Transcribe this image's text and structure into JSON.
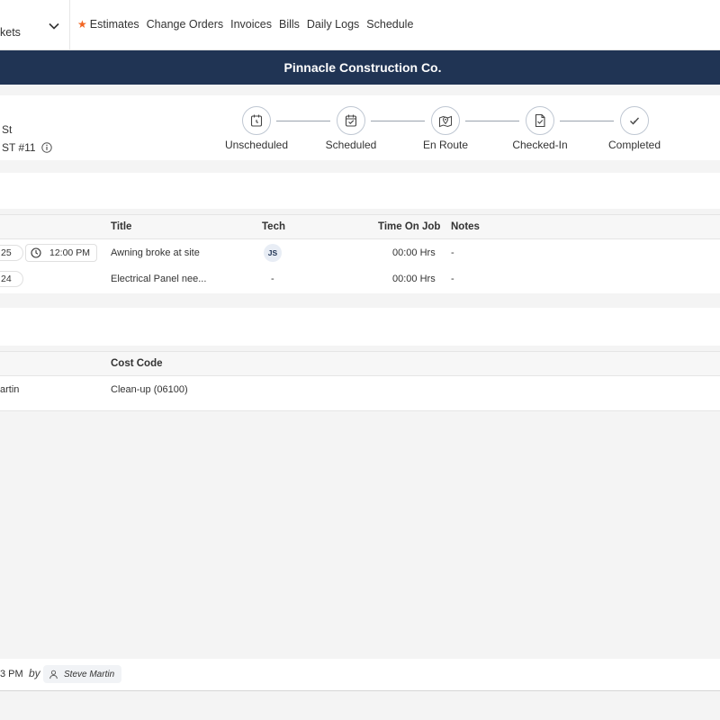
{
  "nav": {
    "module_label": "kets",
    "links": [
      "Estimates",
      "Change Orders",
      "Invoices",
      "Bills",
      "Daily Logs",
      "Schedule"
    ]
  },
  "company": {
    "name": "Pinnacle Construction Co."
  },
  "ticket": {
    "address_fragment": "St",
    "number_fragment": "ST #11"
  },
  "status_steps": [
    {
      "label": "Unscheduled",
      "icon": "calendar-clock-icon"
    },
    {
      "label": "Scheduled",
      "icon": "calendar-check-icon"
    },
    {
      "label": "En Route",
      "icon": "map-pin-icon"
    },
    {
      "label": "Checked-In",
      "icon": "document-check-icon"
    },
    {
      "label": "Completed",
      "icon": "checkmark-icon"
    }
  ],
  "services_table": {
    "headers": {
      "title": "Title",
      "tech": "Tech",
      "time_on_job": "Time On Job",
      "notes": "Notes"
    },
    "rows": [
      {
        "date": "25",
        "time": "12:00 PM",
        "title": "Awning broke at site",
        "tech": "JS",
        "time_on_job": "00:00 Hrs",
        "notes": "-"
      },
      {
        "date": "24",
        "time": "",
        "title": "Electrical Panel nee...",
        "tech": "-",
        "time_on_job": "00:00 Hrs",
        "notes": "-"
      }
    ]
  },
  "cost_table": {
    "headers": {
      "cost_code": "Cost Code"
    },
    "rows": [
      {
        "name": "artin",
        "cost_code": "Clean-up (06100)"
      }
    ]
  },
  "footer": {
    "time_fragment": "3 PM",
    "by_label": "by",
    "user": "Steve Martin"
  },
  "colors": {
    "header_bg": "#203454",
    "accent_star": "#f26522"
  }
}
